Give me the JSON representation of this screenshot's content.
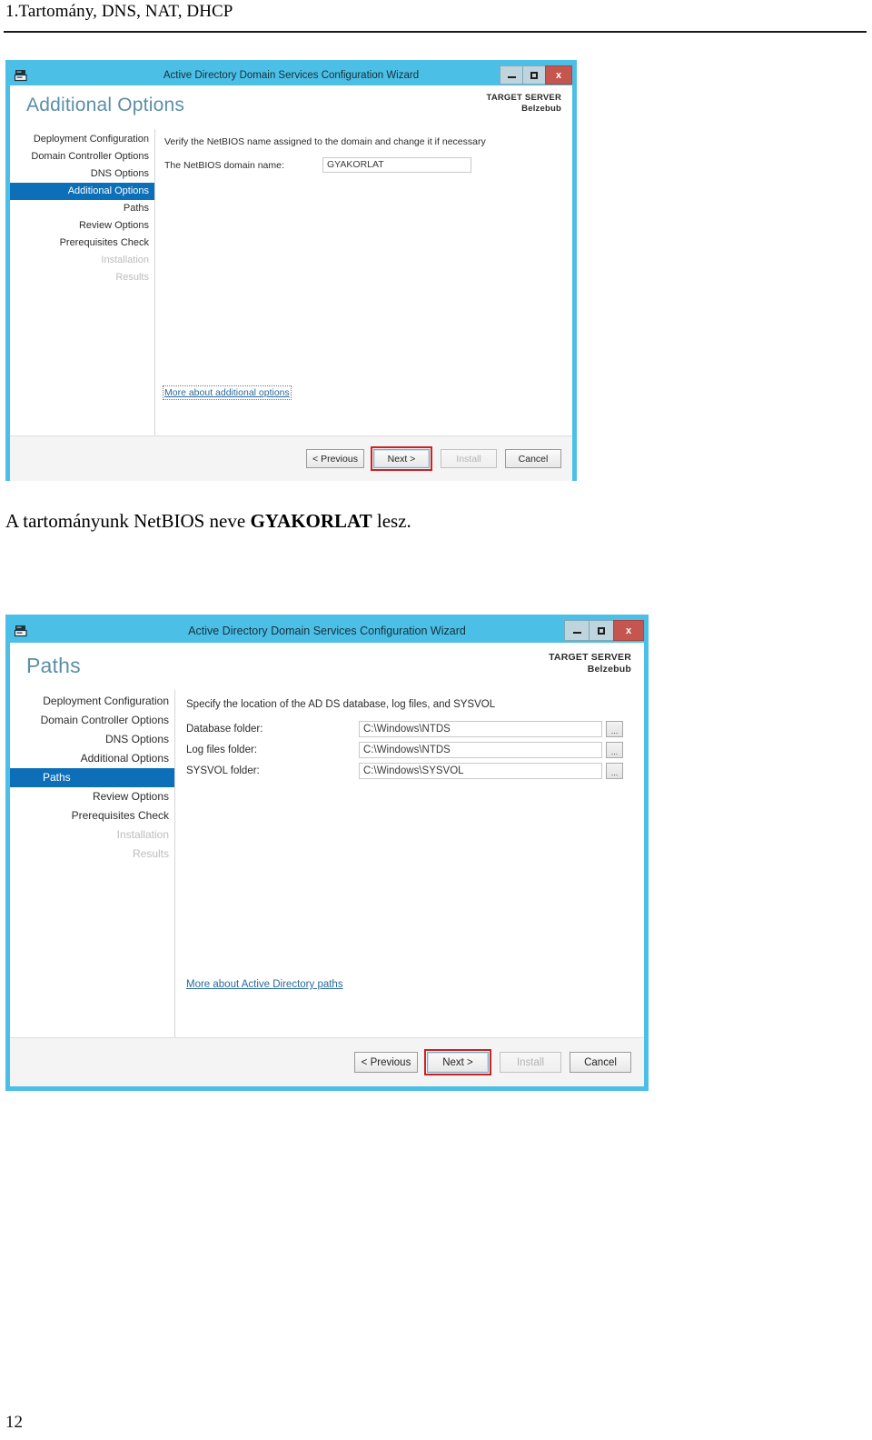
{
  "document": {
    "header_title": "1.Tartomány, DNS, NAT, DHCP",
    "page_number": "12",
    "caption_prefix": "A tartományunk NetBIOS neve ",
    "caption_bold": "GYAKORLAT",
    "caption_suffix": " lesz."
  },
  "colors": {
    "titlebar": "#4cbfe6",
    "nav_selected": "#0d6fb8",
    "page_title": "#5a8fa8",
    "close_button": "#c4564f",
    "highlight_annotation": "#cc2222",
    "link": "#2b6a9b"
  },
  "wizard1": {
    "window_title": "Active Directory Domain Services Configuration Wizard",
    "app_icon": "server-wizard-icon",
    "window_buttons": {
      "minimize": "minimize-icon",
      "maximize": "maximize-icon",
      "close": "x"
    },
    "page_title": "Additional Options",
    "target_server_label": "TARGET SERVER",
    "target_server_name": "Belzebub",
    "nav_items": [
      {
        "label": "Deployment Configuration",
        "state": "normal"
      },
      {
        "label": "Domain Controller Options",
        "state": "normal"
      },
      {
        "label": "DNS Options",
        "state": "normal"
      },
      {
        "label": "Additional Options",
        "state": "selected"
      },
      {
        "label": "Paths",
        "state": "normal"
      },
      {
        "label": "Review Options",
        "state": "normal"
      },
      {
        "label": "Prerequisites Check",
        "state": "normal"
      },
      {
        "label": "Installation",
        "state": "disabled"
      },
      {
        "label": "Results",
        "state": "disabled"
      }
    ],
    "description": "Verify the NetBIOS name assigned to the domain and change it if necessary",
    "field": {
      "label": "The NetBIOS domain name:",
      "value": "GYAKORLAT",
      "placeholder": ""
    },
    "more_link": "More about additional options",
    "buttons": {
      "previous": "< Previous",
      "next": "Next >",
      "install": "Install",
      "cancel": "Cancel"
    }
  },
  "wizard2": {
    "window_title": "Active Directory Domain Services Configuration Wizard",
    "app_icon": "server-wizard-icon",
    "window_buttons": {
      "minimize": "minimize-icon",
      "maximize": "maximize-icon",
      "close": "x"
    },
    "page_title": "Paths",
    "target_server_label": "TARGET SERVER",
    "target_server_name": "Belzebub",
    "nav_items": [
      {
        "label": "Deployment Configuration",
        "state": "normal"
      },
      {
        "label": "Domain Controller Options",
        "state": "normal"
      },
      {
        "label": "DNS Options",
        "state": "normal"
      },
      {
        "label": "Additional Options",
        "state": "normal"
      },
      {
        "label": "Paths",
        "state": "selected"
      },
      {
        "label": "Review Options",
        "state": "normal"
      },
      {
        "label": "Prerequisites Check",
        "state": "normal"
      },
      {
        "label": "Installation",
        "state": "disabled"
      },
      {
        "label": "Results",
        "state": "disabled"
      }
    ],
    "description": "Specify the location of the AD DS database, log files, and SYSVOL",
    "fields": [
      {
        "label": "Database folder:",
        "value": "C:\\Windows\\NTDS",
        "browse": "..."
      },
      {
        "label": "Log files folder:",
        "value": "C:\\Windows\\NTDS",
        "browse": "..."
      },
      {
        "label": "SYSVOL folder:",
        "value": "C:\\Windows\\SYSVOL",
        "browse": "..."
      }
    ],
    "more_link": "More about Active Directory paths",
    "buttons": {
      "previous": "< Previous",
      "next": "Next >",
      "install": "Install",
      "cancel": "Cancel"
    }
  }
}
